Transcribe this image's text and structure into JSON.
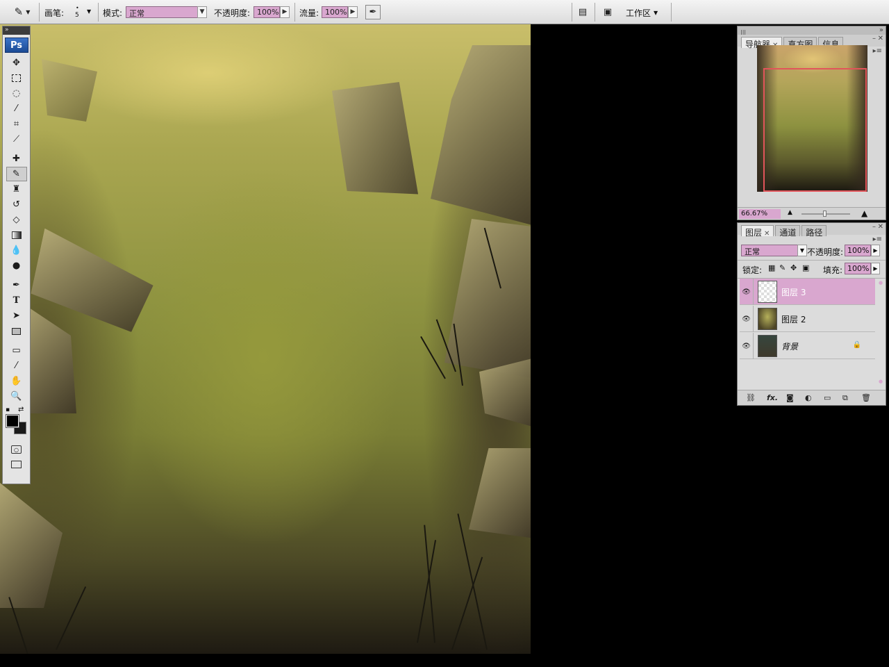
{
  "options_bar": {
    "brush_label": "画笔:",
    "brush_size": "5",
    "mode_label": "模式:",
    "mode_value": "正常",
    "opacity_label": "不透明度:",
    "opacity_value": "100%",
    "flow_label": "流量:",
    "flow_value": "100%",
    "workspace_label": "工作区"
  },
  "toolbox": {
    "logo": "Ps",
    "type_tool_glyph": "T",
    "active_tool": "brush"
  },
  "navigator": {
    "tabs": [
      {
        "label": "导航器",
        "active": true,
        "closable": true
      },
      {
        "label": "直方图",
        "active": false
      },
      {
        "label": "信息",
        "active": false
      }
    ],
    "zoom": "66.67%",
    "view_box_color": "#e2545a"
  },
  "layers": {
    "tabs": [
      {
        "label": "图层",
        "active": true,
        "closable": true
      },
      {
        "label": "通道",
        "active": false
      },
      {
        "label": "路径",
        "active": false
      }
    ],
    "blend_mode": "正常",
    "opacity_label": "不透明度:",
    "opacity_value": "100%",
    "lock_label": "锁定:",
    "fill_label": "填充:",
    "fill_value": "100%",
    "items": [
      {
        "name": "图层 3",
        "selected": true,
        "visible": true,
        "locked": false
      },
      {
        "name": "图层 2",
        "selected": false,
        "visible": true,
        "locked": false
      },
      {
        "name": "背景",
        "selected": false,
        "visible": true,
        "locked": true
      }
    ]
  },
  "colors": {
    "selection_highlight": "#d9a7cf",
    "foreground": "#000000",
    "background": "#1a1a1a"
  }
}
